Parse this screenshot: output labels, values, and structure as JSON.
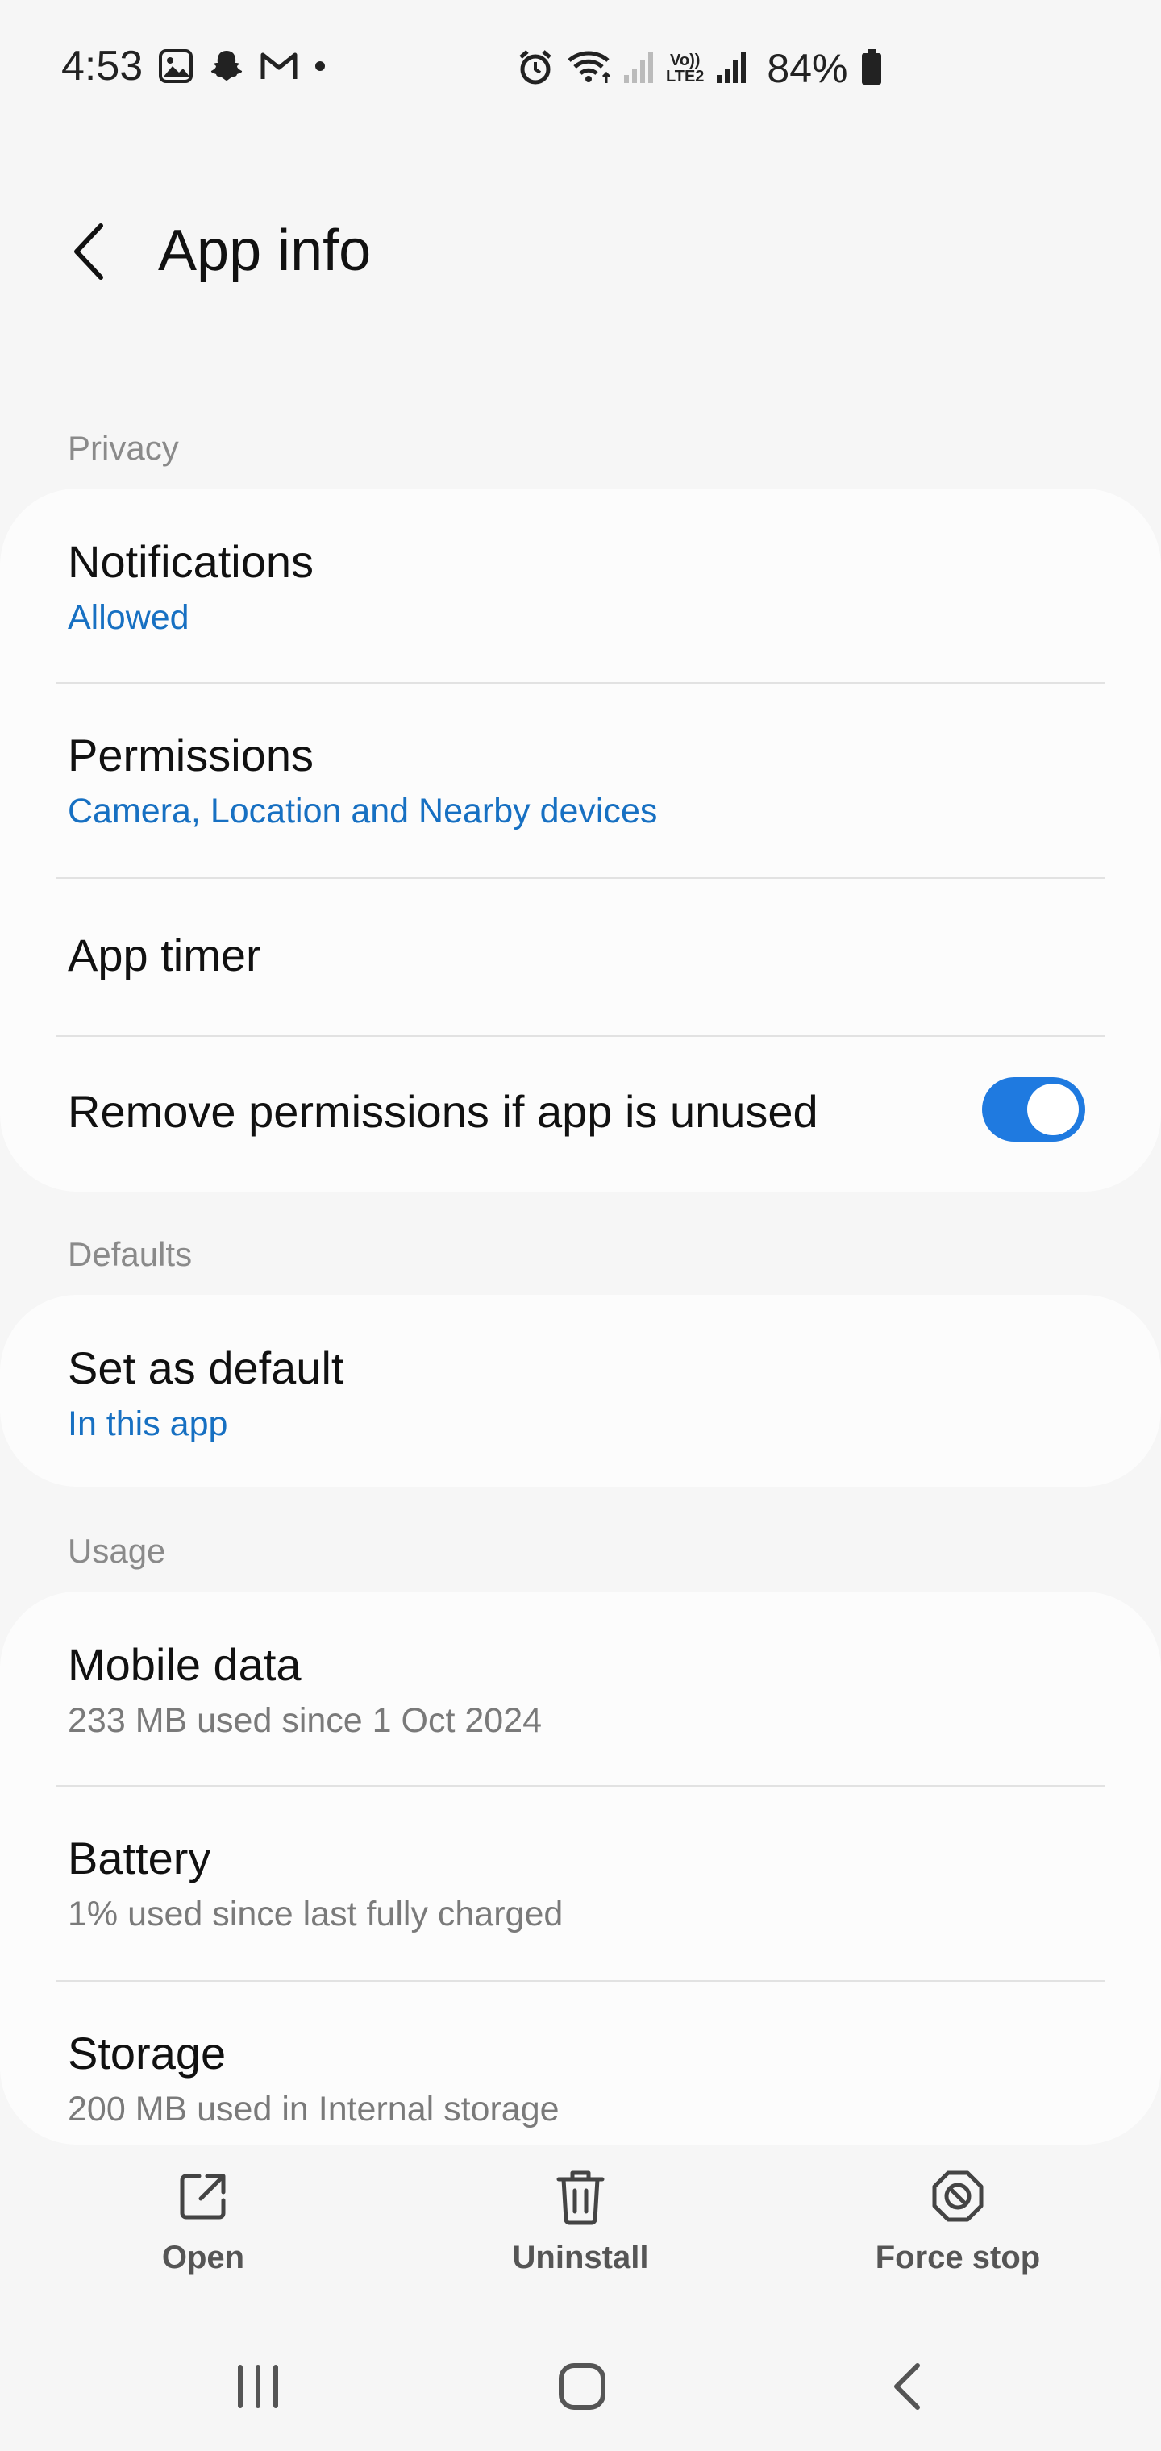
{
  "status_bar": {
    "time": "4:53",
    "left_icons": [
      "gallery-icon",
      "snapchat-icon",
      "gmail-icon",
      "dot-icon"
    ],
    "right_icons": [
      "alarm-icon",
      "wifi-icon",
      "signal-icon",
      "volte-lte2-icon",
      "signal-icon"
    ],
    "volte_label_top": "Vo))",
    "volte_label_bottom": "LTE2",
    "battery_text": "84%"
  },
  "header": {
    "title": "App info"
  },
  "sections": {
    "privacy": {
      "label": "Privacy",
      "items": [
        {
          "title": "Notifications",
          "subtitle": "Allowed"
        },
        {
          "title": "Permissions",
          "subtitle": "Camera, Location and Nearby devices"
        },
        {
          "title": "App timer"
        },
        {
          "title": "Remove permissions if app is unused",
          "toggle_on": true
        }
      ]
    },
    "defaults": {
      "label": "Defaults",
      "items": [
        {
          "title": "Set as default",
          "subtitle": "In this app"
        }
      ]
    },
    "usage": {
      "label": "Usage",
      "items": [
        {
          "title": "Mobile data",
          "subtitle": "233 MB used since 1 Oct 2024"
        },
        {
          "title": "Battery",
          "subtitle": "1% used since last fully charged"
        },
        {
          "title": "Storage",
          "subtitle": "200 MB used in Internal storage"
        }
      ]
    }
  },
  "actions": {
    "open": "Open",
    "uninstall": "Uninstall",
    "force_stop": "Force stop"
  },
  "colors": {
    "accent": "#1770c2",
    "toggle": "#1f7ae0",
    "background": "#f6f6f6",
    "card": "#fcfcfc"
  }
}
